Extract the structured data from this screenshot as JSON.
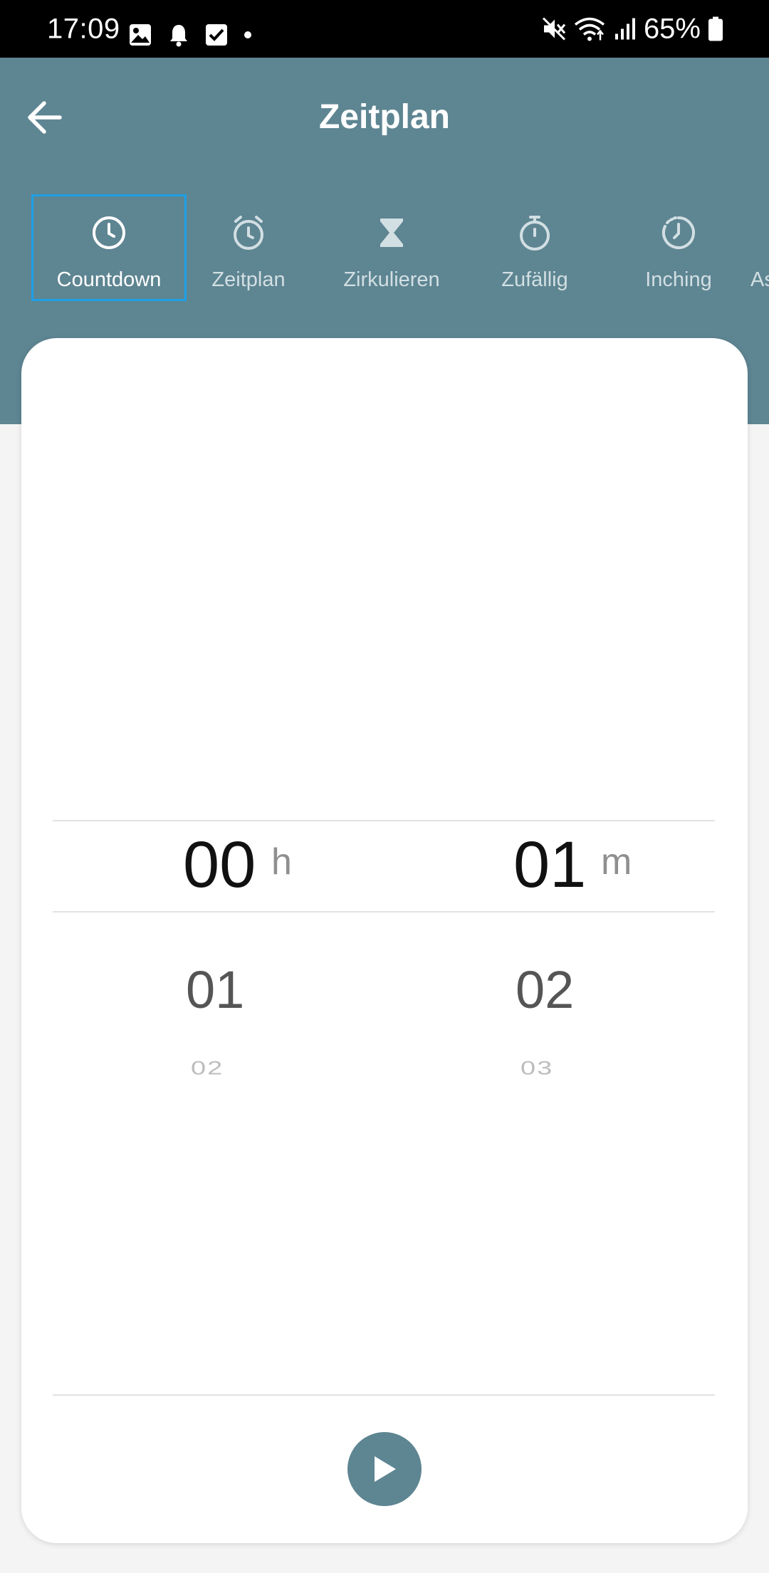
{
  "status_bar": {
    "time": "17:09",
    "battery": "65%",
    "left_icons": [
      "image-icon",
      "bell-icon",
      "checkbox-icon",
      "dot-icon"
    ],
    "right_icons": [
      "mute-icon",
      "wifi-icon",
      "signal-icon",
      "battery-icon"
    ]
  },
  "header": {
    "title": "Zeitplan",
    "back_icon": "arrow-left-icon",
    "background": "#5e8592"
  },
  "tabs": [
    {
      "label": "Countdown",
      "icon": "clock-icon",
      "active": true
    },
    {
      "label": "Zeitplan",
      "icon": "alarm-clock-icon",
      "active": false
    },
    {
      "label": "Zirkulieren",
      "icon": "hourglass-icon",
      "active": false
    },
    {
      "label": "Zufällig",
      "icon": "stopwatch-icon",
      "active": false
    },
    {
      "label": "Inching",
      "icon": "dotted-clock-icon",
      "active": false
    }
  ],
  "tab_partial": "As",
  "picker": {
    "hours": {
      "selected": "00",
      "unit": "h",
      "next": "01",
      "next2": "02"
    },
    "minutes": {
      "selected": "01",
      "unit": "m",
      "next": "02",
      "next2": "03"
    }
  },
  "actions": {
    "play_icon": "play-icon"
  },
  "colors": {
    "accent": "#5e8592",
    "active_tab_outline": "#1ea0e6"
  }
}
